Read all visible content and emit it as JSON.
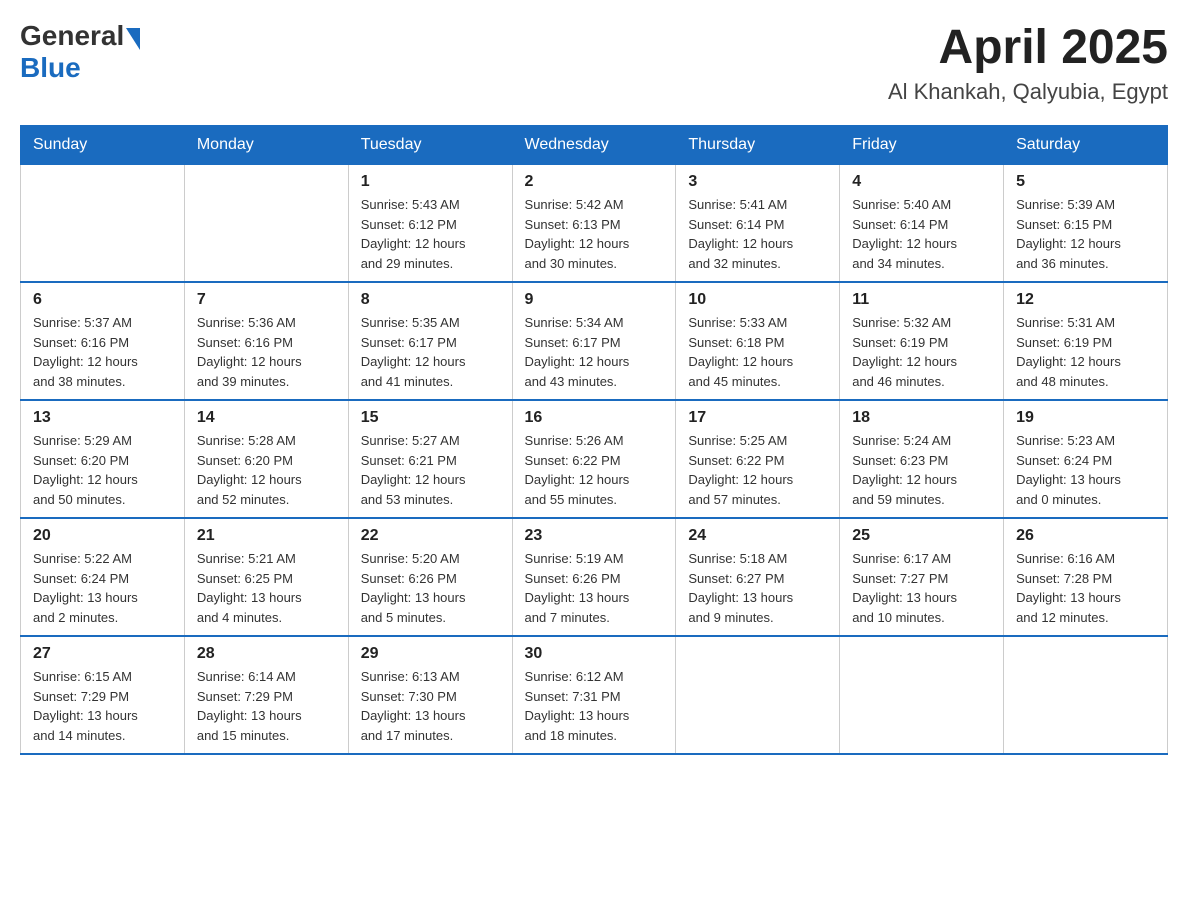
{
  "header": {
    "logo_general": "General",
    "logo_blue": "Blue",
    "month_year": "April 2025",
    "location": "Al Khankah, Qalyubia, Egypt"
  },
  "weekdays": [
    "Sunday",
    "Monday",
    "Tuesday",
    "Wednesday",
    "Thursday",
    "Friday",
    "Saturday"
  ],
  "weeks": [
    [
      {
        "day": "",
        "info": ""
      },
      {
        "day": "",
        "info": ""
      },
      {
        "day": "1",
        "info": "Sunrise: 5:43 AM\nSunset: 6:12 PM\nDaylight: 12 hours\nand 29 minutes."
      },
      {
        "day": "2",
        "info": "Sunrise: 5:42 AM\nSunset: 6:13 PM\nDaylight: 12 hours\nand 30 minutes."
      },
      {
        "day": "3",
        "info": "Sunrise: 5:41 AM\nSunset: 6:14 PM\nDaylight: 12 hours\nand 32 minutes."
      },
      {
        "day": "4",
        "info": "Sunrise: 5:40 AM\nSunset: 6:14 PM\nDaylight: 12 hours\nand 34 minutes."
      },
      {
        "day": "5",
        "info": "Sunrise: 5:39 AM\nSunset: 6:15 PM\nDaylight: 12 hours\nand 36 minutes."
      }
    ],
    [
      {
        "day": "6",
        "info": "Sunrise: 5:37 AM\nSunset: 6:16 PM\nDaylight: 12 hours\nand 38 minutes."
      },
      {
        "day": "7",
        "info": "Sunrise: 5:36 AM\nSunset: 6:16 PM\nDaylight: 12 hours\nand 39 minutes."
      },
      {
        "day": "8",
        "info": "Sunrise: 5:35 AM\nSunset: 6:17 PM\nDaylight: 12 hours\nand 41 minutes."
      },
      {
        "day": "9",
        "info": "Sunrise: 5:34 AM\nSunset: 6:17 PM\nDaylight: 12 hours\nand 43 minutes."
      },
      {
        "day": "10",
        "info": "Sunrise: 5:33 AM\nSunset: 6:18 PM\nDaylight: 12 hours\nand 45 minutes."
      },
      {
        "day": "11",
        "info": "Sunrise: 5:32 AM\nSunset: 6:19 PM\nDaylight: 12 hours\nand 46 minutes."
      },
      {
        "day": "12",
        "info": "Sunrise: 5:31 AM\nSunset: 6:19 PM\nDaylight: 12 hours\nand 48 minutes."
      }
    ],
    [
      {
        "day": "13",
        "info": "Sunrise: 5:29 AM\nSunset: 6:20 PM\nDaylight: 12 hours\nand 50 minutes."
      },
      {
        "day": "14",
        "info": "Sunrise: 5:28 AM\nSunset: 6:20 PM\nDaylight: 12 hours\nand 52 minutes."
      },
      {
        "day": "15",
        "info": "Sunrise: 5:27 AM\nSunset: 6:21 PM\nDaylight: 12 hours\nand 53 minutes."
      },
      {
        "day": "16",
        "info": "Sunrise: 5:26 AM\nSunset: 6:22 PM\nDaylight: 12 hours\nand 55 minutes."
      },
      {
        "day": "17",
        "info": "Sunrise: 5:25 AM\nSunset: 6:22 PM\nDaylight: 12 hours\nand 57 minutes."
      },
      {
        "day": "18",
        "info": "Sunrise: 5:24 AM\nSunset: 6:23 PM\nDaylight: 12 hours\nand 59 minutes."
      },
      {
        "day": "19",
        "info": "Sunrise: 5:23 AM\nSunset: 6:24 PM\nDaylight: 13 hours\nand 0 minutes."
      }
    ],
    [
      {
        "day": "20",
        "info": "Sunrise: 5:22 AM\nSunset: 6:24 PM\nDaylight: 13 hours\nand 2 minutes."
      },
      {
        "day": "21",
        "info": "Sunrise: 5:21 AM\nSunset: 6:25 PM\nDaylight: 13 hours\nand 4 minutes."
      },
      {
        "day": "22",
        "info": "Sunrise: 5:20 AM\nSunset: 6:26 PM\nDaylight: 13 hours\nand 5 minutes."
      },
      {
        "day": "23",
        "info": "Sunrise: 5:19 AM\nSunset: 6:26 PM\nDaylight: 13 hours\nand 7 minutes."
      },
      {
        "day": "24",
        "info": "Sunrise: 5:18 AM\nSunset: 6:27 PM\nDaylight: 13 hours\nand 9 minutes."
      },
      {
        "day": "25",
        "info": "Sunrise: 6:17 AM\nSunset: 7:27 PM\nDaylight: 13 hours\nand 10 minutes."
      },
      {
        "day": "26",
        "info": "Sunrise: 6:16 AM\nSunset: 7:28 PM\nDaylight: 13 hours\nand 12 minutes."
      }
    ],
    [
      {
        "day": "27",
        "info": "Sunrise: 6:15 AM\nSunset: 7:29 PM\nDaylight: 13 hours\nand 14 minutes."
      },
      {
        "day": "28",
        "info": "Sunrise: 6:14 AM\nSunset: 7:29 PM\nDaylight: 13 hours\nand 15 minutes."
      },
      {
        "day": "29",
        "info": "Sunrise: 6:13 AM\nSunset: 7:30 PM\nDaylight: 13 hours\nand 17 minutes."
      },
      {
        "day": "30",
        "info": "Sunrise: 6:12 AM\nSunset: 7:31 PM\nDaylight: 13 hours\nand 18 minutes."
      },
      {
        "day": "",
        "info": ""
      },
      {
        "day": "",
        "info": ""
      },
      {
        "day": "",
        "info": ""
      }
    ]
  ]
}
